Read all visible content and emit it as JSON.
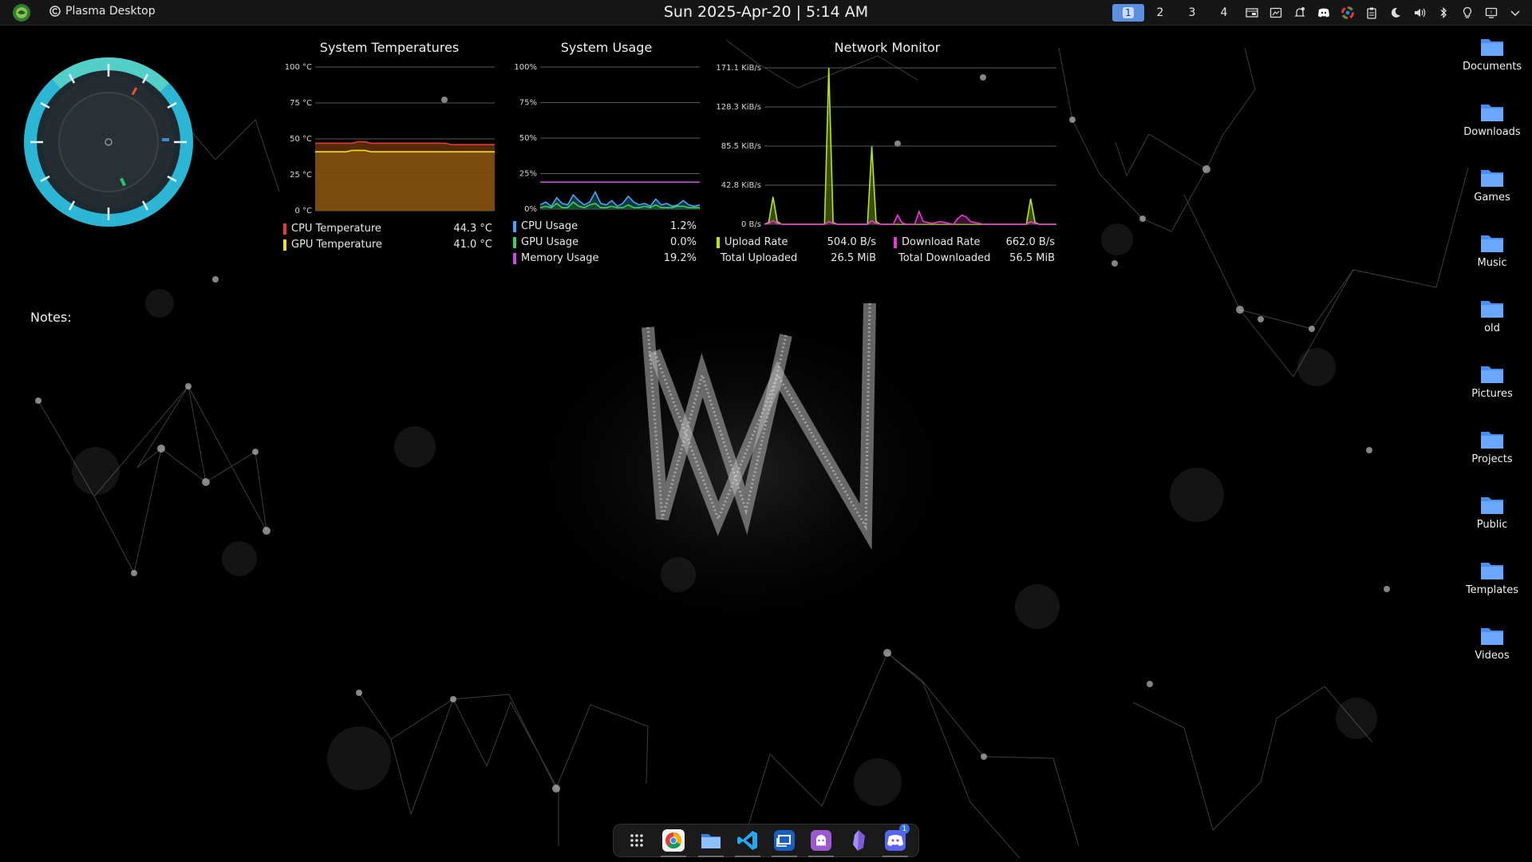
{
  "panel": {
    "window_title": "Plasma Desktop",
    "clock": "Sun 2025-Apr-20 | 5:14 AM",
    "workspaces": [
      {
        "label": "1",
        "active": true
      },
      {
        "label": "2",
        "active": false
      },
      {
        "label": "3",
        "active": false
      },
      {
        "label": "4",
        "active": false
      }
    ],
    "tray_icons": [
      "window-list-icon",
      "screenshot-icon",
      "notifications-icon",
      "discord-icon",
      "color-picker-icon",
      "clipboard-icon",
      "night-mode-icon",
      "volume-icon",
      "bluetooth-icon",
      "lightbulb-icon",
      "display-icon",
      "expand-tray-icon"
    ]
  },
  "temps": {
    "title": "System Temperatures",
    "rows": [
      {
        "label": "CPU Temperature",
        "value": "44.3 °C",
        "color": "#e53935"
      },
      {
        "label": "GPU Temperature",
        "value": "41.0 °C",
        "color": "#f5e400"
      }
    ]
  },
  "usage": {
    "title": "System Usage",
    "rows": [
      {
        "label": "CPU Usage",
        "value": "1.2%",
        "color": "#4aa3ff"
      },
      {
        "label": "GPU Usage",
        "value": "0.0%",
        "color": "#3bd15a"
      },
      {
        "label": "Memory Usage",
        "value": "19.2%",
        "color": "#c84dd8"
      }
    ]
  },
  "network": {
    "title": "Network Monitor",
    "rows": [
      {
        "label": "Upload Rate",
        "value": "504.0 B/s",
        "color": "#b4e61c"
      },
      {
        "label": "Download Rate",
        "value": "662.0 B/s",
        "color": "#e53ad6"
      },
      {
        "label": "Total Uploaded",
        "value": "26.5 MiB"
      },
      {
        "label": "Total Downloaded",
        "value": "56.5 MiB"
      }
    ]
  },
  "notes": {
    "label": "Notes:"
  },
  "folders": [
    "Documents",
    "Downloads",
    "Games",
    "Music",
    "old",
    "Pictures",
    "Projects",
    "Public",
    "Templates",
    "Videos"
  ],
  "dock": {
    "items": [
      "app-launcher-icon",
      "chrome-icon",
      "file-manager-icon",
      "vscode-icon",
      "windows-app-icon",
      "github-icon",
      "obsidian-icon",
      "discord-icon"
    ],
    "discord_badge": "1"
  },
  "chart_data": [
    {
      "type": "area",
      "title": "System Temperatures",
      "ylim": [
        0,
        100
      ],
      "yticks": [
        "100 °C",
        "75 °C",
        "50 °C",
        "25 °C",
        "0 °C"
      ],
      "series": [
        {
          "name": "CPU Temperature",
          "color": "#e53935",
          "values": [
            47,
            47,
            47,
            47,
            47,
            47,
            47,
            48,
            48,
            47,
            47,
            47,
            47,
            47,
            47,
            47,
            47,
            47,
            47,
            47,
            47,
            47,
            46,
            46,
            46,
            46,
            46,
            46,
            46,
            46
          ]
        },
        {
          "name": "GPU Temperature",
          "color": "#f5e400",
          "values": [
            41,
            41,
            41,
            41,
            41,
            41,
            42,
            42,
            42,
            41,
            41,
            41,
            41,
            41,
            41,
            41,
            41,
            41,
            41,
            41,
            41,
            41,
            41,
            41,
            41,
            41,
            41,
            41,
            41,
            41
          ]
        }
      ]
    },
    {
      "type": "line",
      "title": "System Usage",
      "ylim": [
        0,
        100
      ],
      "yticks": [
        "100%",
        "75%",
        "50%",
        "25%",
        "0%"
      ],
      "series": [
        {
          "name": "Memory Usage",
          "color": "#c84dd8",
          "values": [
            19,
            19,
            19,
            19,
            19,
            19,
            19,
            19,
            19,
            19,
            19,
            19,
            19,
            19,
            19,
            19,
            19,
            19,
            19,
            19,
            19,
            19,
            19,
            19,
            19,
            19,
            19,
            19,
            19,
            19
          ]
        },
        {
          "name": "CPU Usage",
          "color": "#4aa3ff",
          "values": [
            3,
            5,
            2,
            8,
            4,
            3,
            10,
            6,
            3,
            5,
            12,
            4,
            3,
            6,
            2,
            4,
            9,
            5,
            3,
            4,
            2,
            7,
            3,
            4,
            2,
            3,
            6,
            3,
            2,
            3
          ]
        },
        {
          "name": "GPU Usage",
          "color": "#3bd15a",
          "values": [
            1,
            2,
            1,
            4,
            1,
            1,
            5,
            2,
            1,
            3,
            4,
            1,
            1,
            2,
            1,
            1,
            3,
            1,
            1,
            2,
            1,
            3,
            1,
            1,
            1,
            2,
            2,
            1,
            1,
            1
          ]
        }
      ]
    },
    {
      "type": "area",
      "title": "Network Monitor",
      "ylim": [
        0,
        171.1
      ],
      "yticks": [
        "171.1 KiB/s",
        "128.3 KiB/s",
        "85.5 KiB/s",
        "42.8 KiB/s",
        "0 B/s"
      ],
      "series": [
        {
          "name": "Upload Rate",
          "color": "#b4e61c",
          "values": [
            0,
            2,
            30,
            3,
            0,
            0,
            0,
            0,
            0,
            0,
            0,
            0,
            0,
            0,
            0,
            171,
            2,
            0,
            0,
            0,
            0,
            0,
            0,
            0,
            0,
            85,
            3,
            0,
            0,
            0,
            0,
            0,
            0,
            0,
            0,
            0,
            0,
            0,
            0,
            0,
            0,
            0,
            0,
            0,
            0,
            0,
            0,
            0,
            0,
            0,
            0,
            0,
            0,
            0,
            0,
            0,
            0,
            0,
            0,
            0,
            0,
            0,
            28,
            2,
            0,
            0,
            0,
            0,
            0
          ]
        },
        {
          "name": "Download Rate",
          "color": "#e53ad6",
          "values": [
            0,
            1,
            4,
            1,
            0,
            0,
            0,
            0,
            0,
            0,
            0,
            0,
            0,
            0,
            0,
            3,
            1,
            0,
            0,
            0,
            0,
            0,
            0,
            0,
            0,
            4,
            1,
            0,
            0,
            0,
            0,
            10,
            2,
            0,
            0,
            0,
            14,
            3,
            2,
            1,
            2,
            3,
            2,
            1,
            0,
            6,
            10,
            8,
            3,
            2,
            1,
            0,
            0,
            0,
            0,
            0,
            0,
            0,
            0,
            0,
            0,
            0,
            3,
            1,
            0,
            0,
            0,
            0,
            0
          ]
        }
      ]
    }
  ]
}
